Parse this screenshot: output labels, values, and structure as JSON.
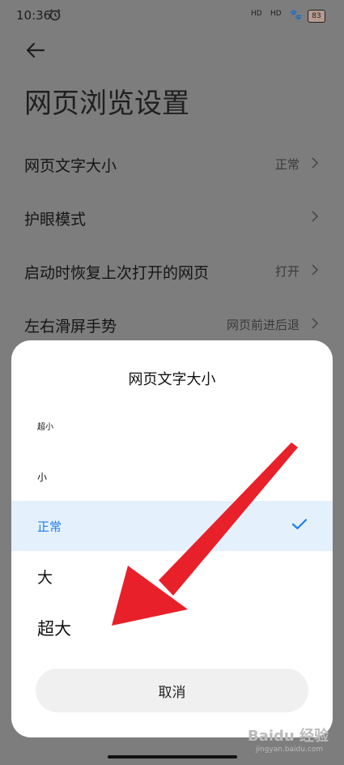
{
  "status": {
    "time": "10:36",
    "battery": "83",
    "signal1": "HD",
    "signal2": "HD"
  },
  "page": {
    "title": "网页浏览设置"
  },
  "settings": [
    {
      "label": "网页文字大小",
      "value": "正常"
    },
    {
      "label": "护眼模式",
      "value": ""
    },
    {
      "label": "启动时恢复上次打开的网页",
      "value": "打开"
    },
    {
      "label": "左右滑屏手势",
      "value": "网页前进后退"
    }
  ],
  "dialog": {
    "title": "网页文字大小",
    "options": [
      {
        "label": "超小",
        "selected": false
      },
      {
        "label": "小",
        "selected": false
      },
      {
        "label": "正常",
        "selected": true
      },
      {
        "label": "大",
        "selected": false
      },
      {
        "label": "超大",
        "selected": false
      }
    ],
    "cancel": "取消"
  },
  "watermark": {
    "brand": "Baidu 经验",
    "url": "jingyan.baidu.com"
  },
  "colors": {
    "accent": "#1f7ee8",
    "selected_bg": "#e4f0fc",
    "arrow": "#e8202a"
  }
}
